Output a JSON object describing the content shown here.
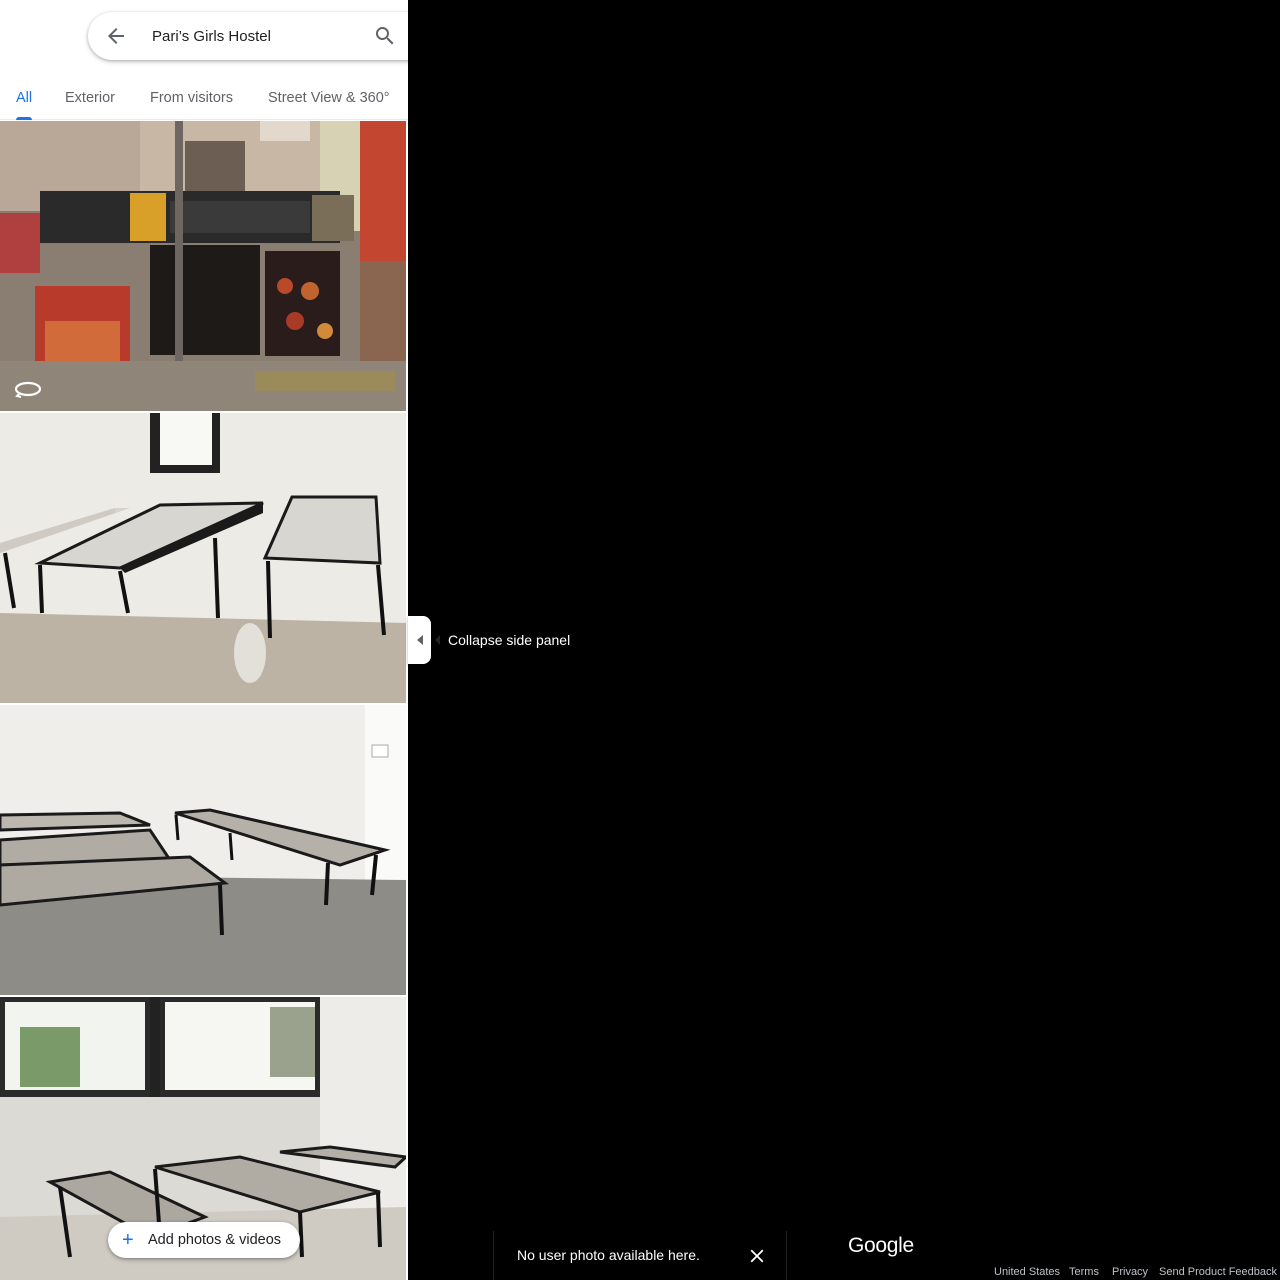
{
  "search": {
    "value": "Pari’s Girls Hostel"
  },
  "tabs": [
    {
      "label": "All",
      "active": true
    },
    {
      "label": "Exterior",
      "active": false
    },
    {
      "label": "From visitors",
      "active": false
    },
    {
      "label": "Street View & 360°",
      "active": false
    }
  ],
  "photos": [
    {
      "kind": "street-view-storefront",
      "has_360_badge": true
    },
    {
      "kind": "room-beds"
    },
    {
      "kind": "room-beds"
    },
    {
      "kind": "room-beds-windows"
    }
  ],
  "add_button": {
    "label": "Add photos & videos",
    "icon": "plus-icon"
  },
  "collapse": {
    "tooltip": "Collapse side panel",
    "icon": "caret-left-icon"
  },
  "snackbar": {
    "text": "No user photo available here.",
    "icon": "close-icon"
  },
  "logo": {
    "text": "Google"
  },
  "footer": {
    "region": "United States",
    "terms": "Terms",
    "privacy": "Privacy",
    "feedback": "Send Product Feedback"
  },
  "colors": {
    "accent": "#1a73e8",
    "map_bg": "#000000",
    "panel_bg": "#ffffff"
  }
}
